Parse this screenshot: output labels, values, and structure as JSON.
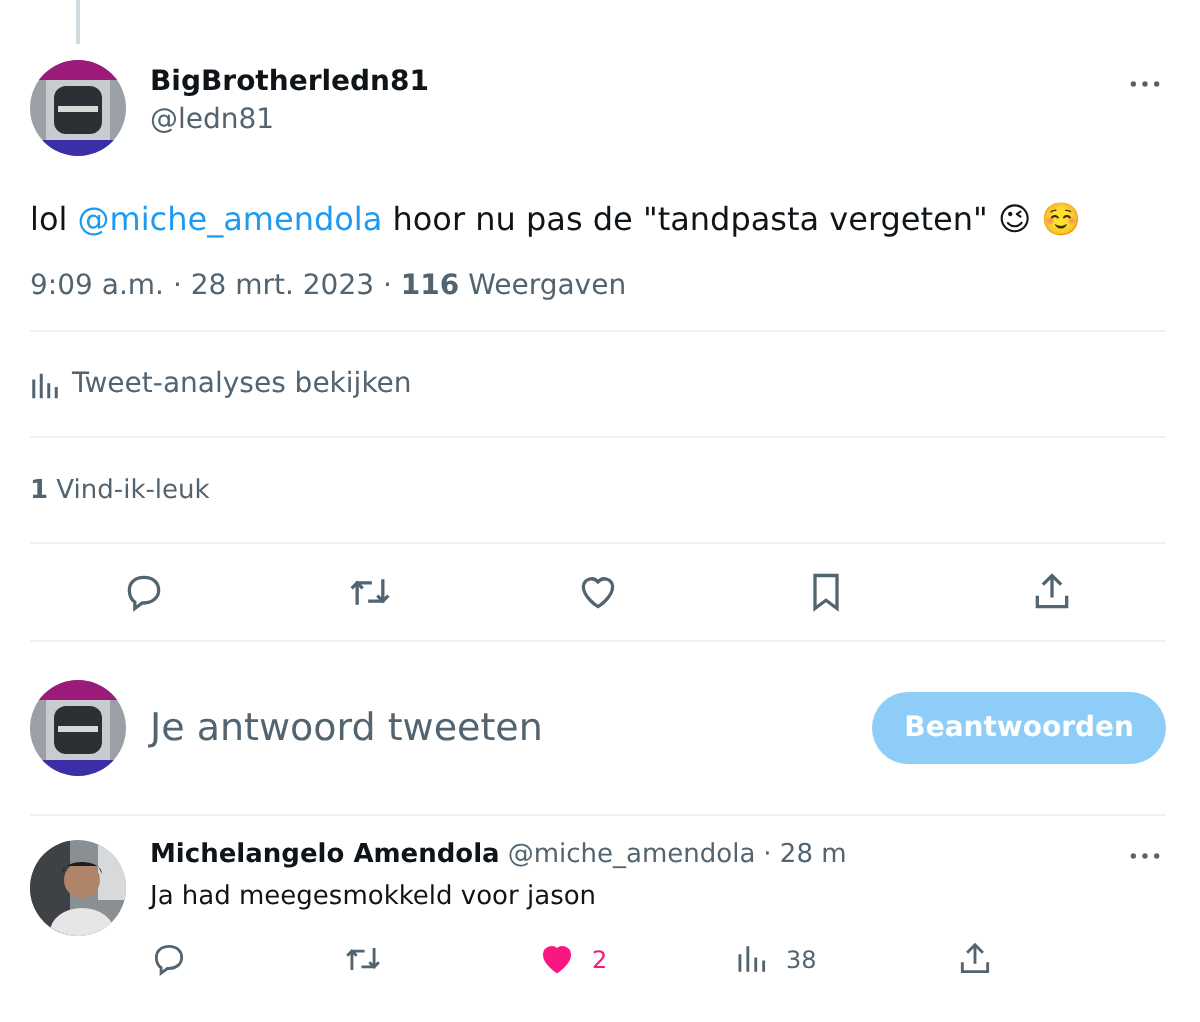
{
  "tweet": {
    "author_name": "BigBrotherledn81",
    "handle": "@ledn81",
    "text_before": "lol ",
    "mention": "@miche_amendola",
    "text_after": " hoor nu pas de \"tandpasta vergeten\" 😉 ☺️",
    "meta": "9:09 a.m. · 28 mrt. 2023 · **116** Weergaven",
    "analytics": "Tweet-analyses bekijken",
    "likes": "**1** Vind-ik-leuk",
    "actions": [
      {
        "kind": "reply"
      },
      {
        "kind": "retweet"
      },
      {
        "kind": "like"
      },
      {
        "kind": "bookmark"
      },
      {
        "kind": "share"
      }
    ]
  },
  "composer": {
    "placeholder": "Je antwoord tweeten",
    "button": "Beantwoorden",
    "disabled": true
  },
  "reply": {
    "author_name": "Michelangelo Amendola",
    "handle": "@miche_amendola",
    "time": "· 28 m",
    "text": "Ja had meegesmokkeld voor jason",
    "actions": [
      {
        "kind": "reply"
      },
      {
        "kind": "retweet"
      },
      {
        "kind": "like",
        "count": "2",
        "active": true
      },
      {
        "kind": "views",
        "count": "38"
      },
      {
        "kind": "share"
      }
    ]
  }
}
